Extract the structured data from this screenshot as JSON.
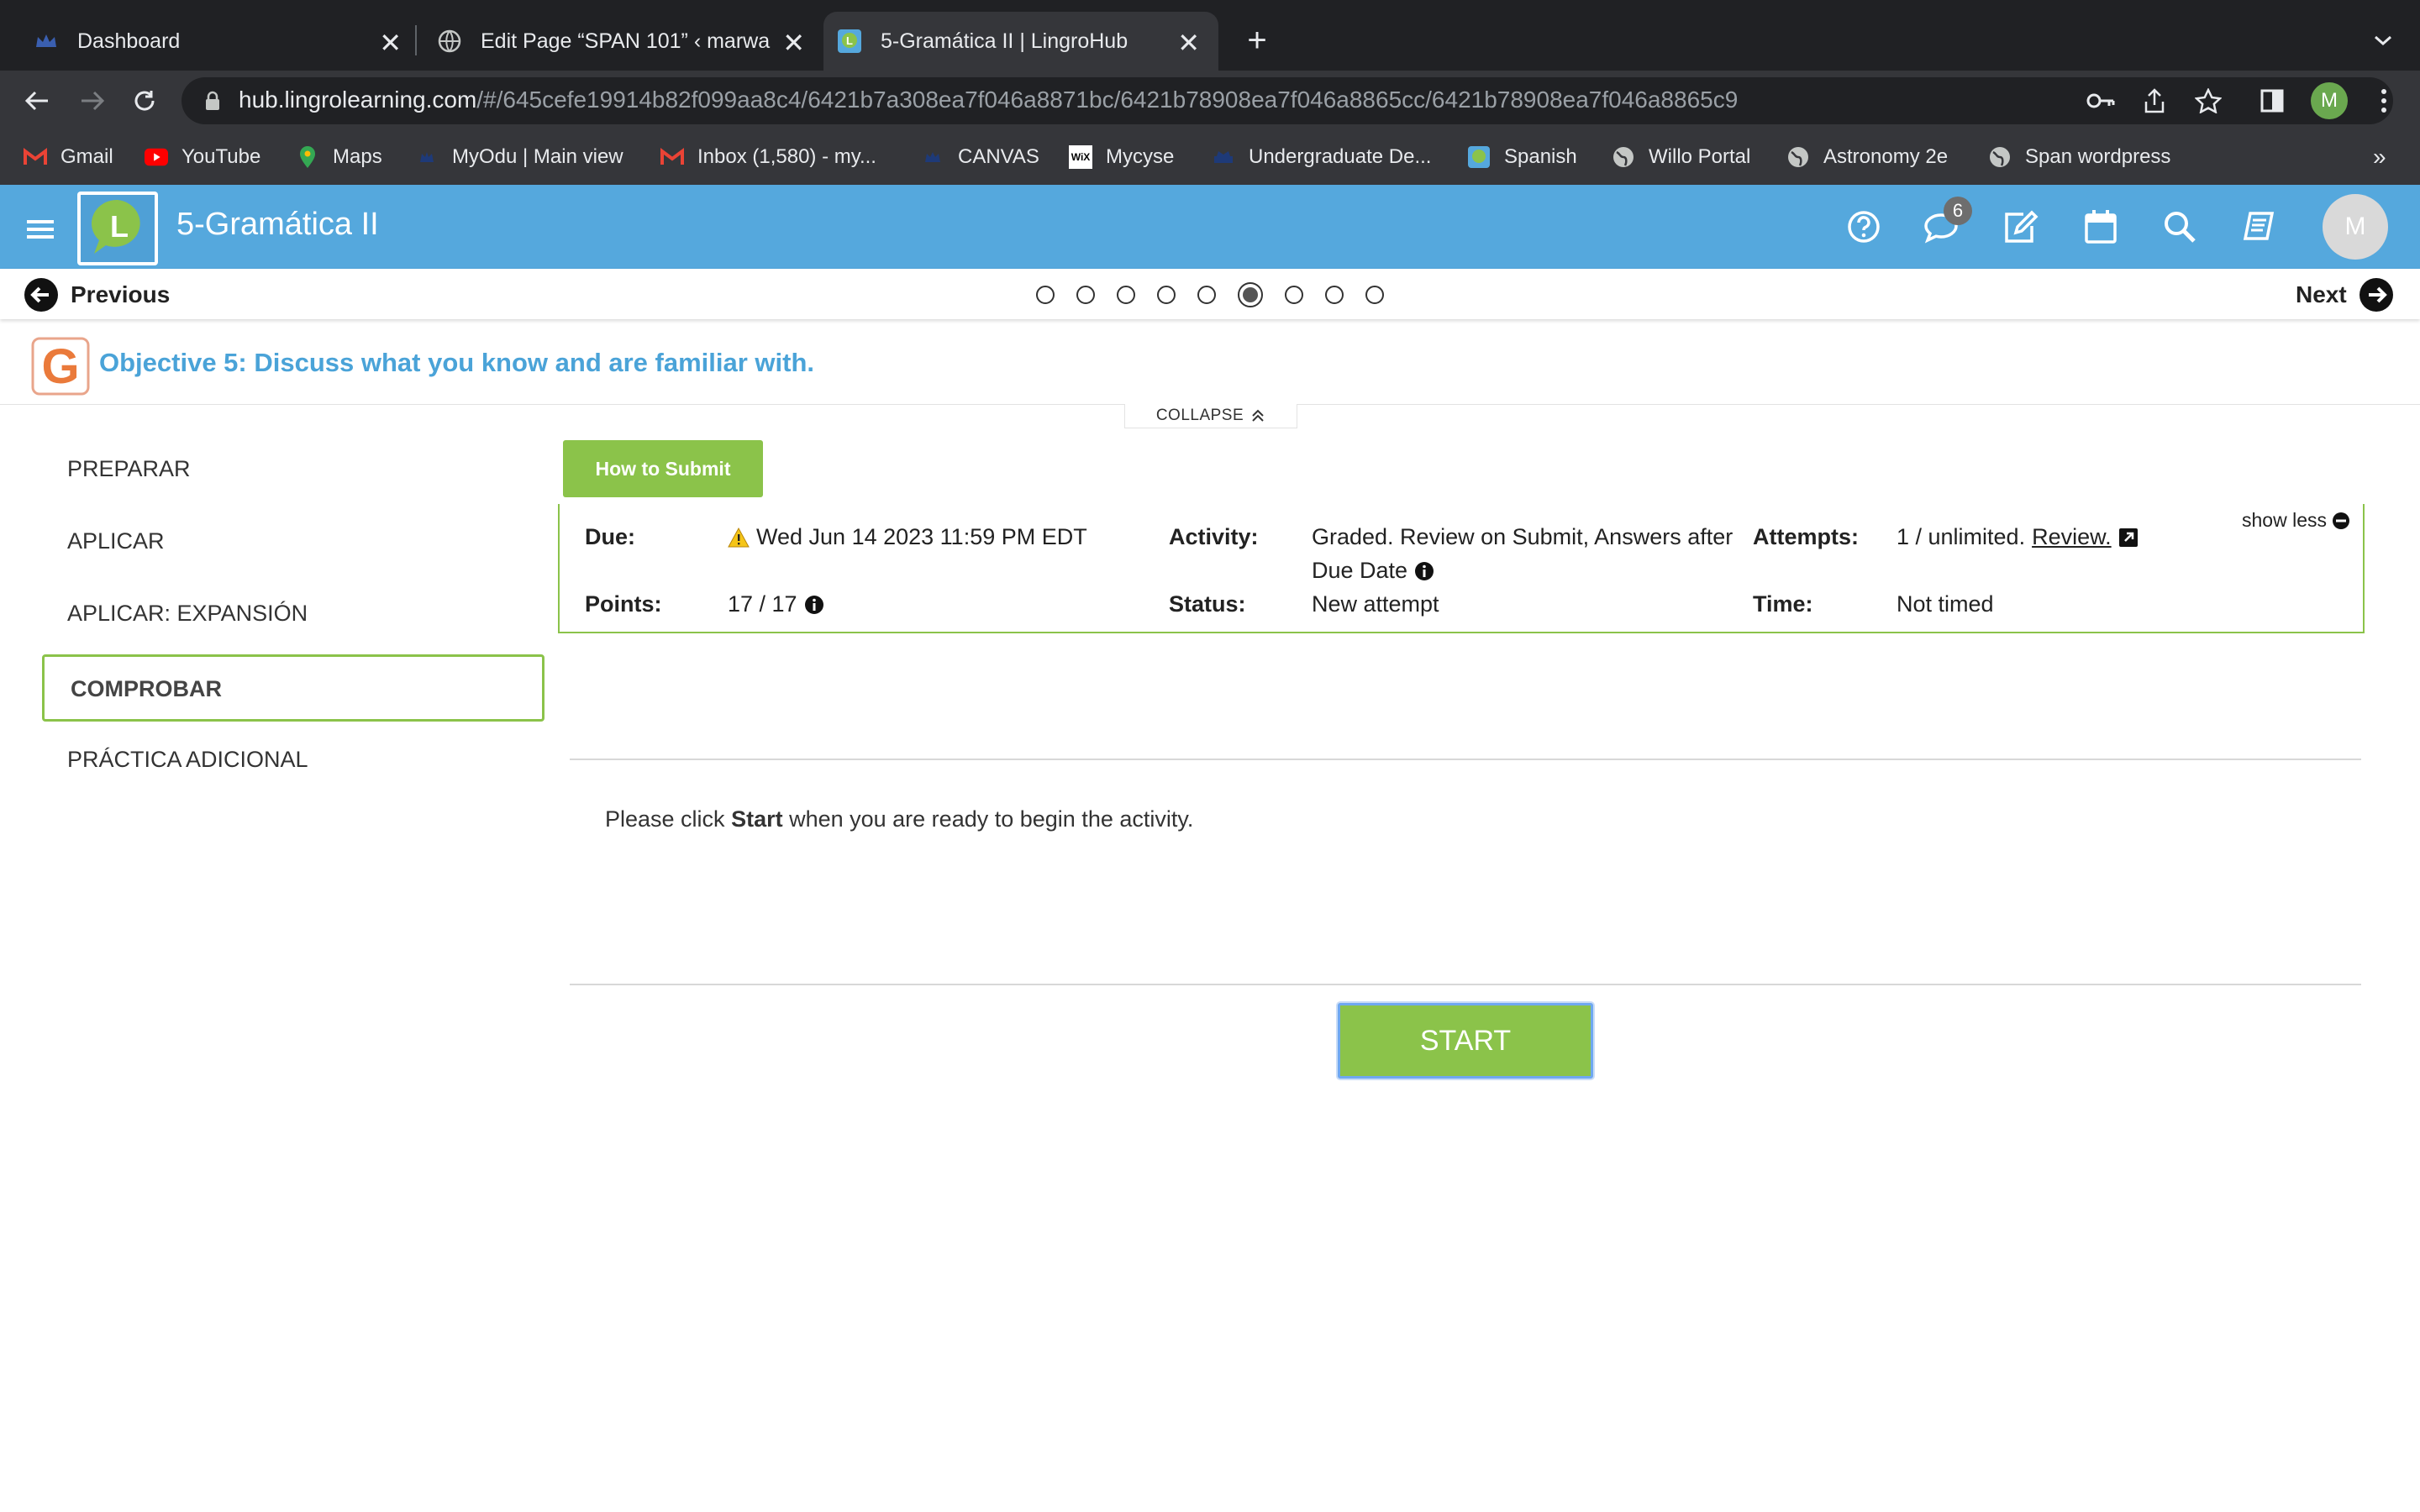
{
  "browser": {
    "tabs": [
      {
        "title": "Dashboard",
        "active": false
      },
      {
        "title": "Edit Page “SPAN 101” ‹ marwa",
        "active": false
      },
      {
        "title": "5-Gramática II | LingroHub",
        "active": true
      }
    ],
    "url_host": "hub.lingrolearning.com",
    "url_path": "/#/645cefe19914b82f099aa8c4/6421b7a308ea7f046a8871bc/6421b78908ea7f046a8865cc/6421b78908ea7f046a8865c9",
    "profile_initial": "M",
    "bookmarks": [
      "Gmail",
      "YouTube",
      "Maps",
      "MyOdu | Main view",
      "Inbox (1,580) - my...",
      "CANVAS",
      "Mycyse",
      "Undergraduate De...",
      "Spanish",
      "Willo Portal",
      "Astronomy 2e",
      "Span wordpress"
    ],
    "more_bookmarks": "»"
  },
  "app": {
    "title": "5-Gramática II",
    "logo_letter": "L",
    "messages_badge": "6",
    "avatar_initial": "M",
    "colors": {
      "header": "#55a8dd",
      "accent_green": "#8bc34a",
      "objective_blue": "#4aa3d8"
    }
  },
  "nav": {
    "previous_label": "Previous",
    "next_label": "Next",
    "page_count": 9,
    "current_page": 6
  },
  "objective": {
    "badge_letter": "G",
    "title": "Objective 5: Discuss what you know and are familiar with.",
    "collapse_label": "COLLAPSE"
  },
  "menu": {
    "items": [
      "PREPARAR",
      "APLICAR",
      "APLICAR: EXPANSIÓN",
      "COMPROBAR",
      "PRÁCTICA ADICIONAL"
    ],
    "active": "COMPROBAR"
  },
  "activity": {
    "how_to_submit": "How to Submit",
    "due_label": "Due:",
    "due_value": "Wed Jun 14 2023 11:59 PM EDT",
    "activity_label": "Activity:",
    "activity_value_line1": "Graded. Review on Submit, Answers after",
    "activity_value_line2": "Due Date",
    "attempts_label": "Attempts:",
    "attempts_value": "1 / unlimited.",
    "attempts_review": "Review.",
    "points_label": "Points:",
    "points_value": "17 / 17",
    "status_label": "Status:",
    "status_value": "New attempt",
    "time_label": "Time:",
    "time_value": "Not timed",
    "show_less": "show less",
    "instruction_pre": "Please click ",
    "instruction_bold": "Start",
    "instruction_post": " when you are ready to begin the activity.",
    "start_label": "START"
  }
}
